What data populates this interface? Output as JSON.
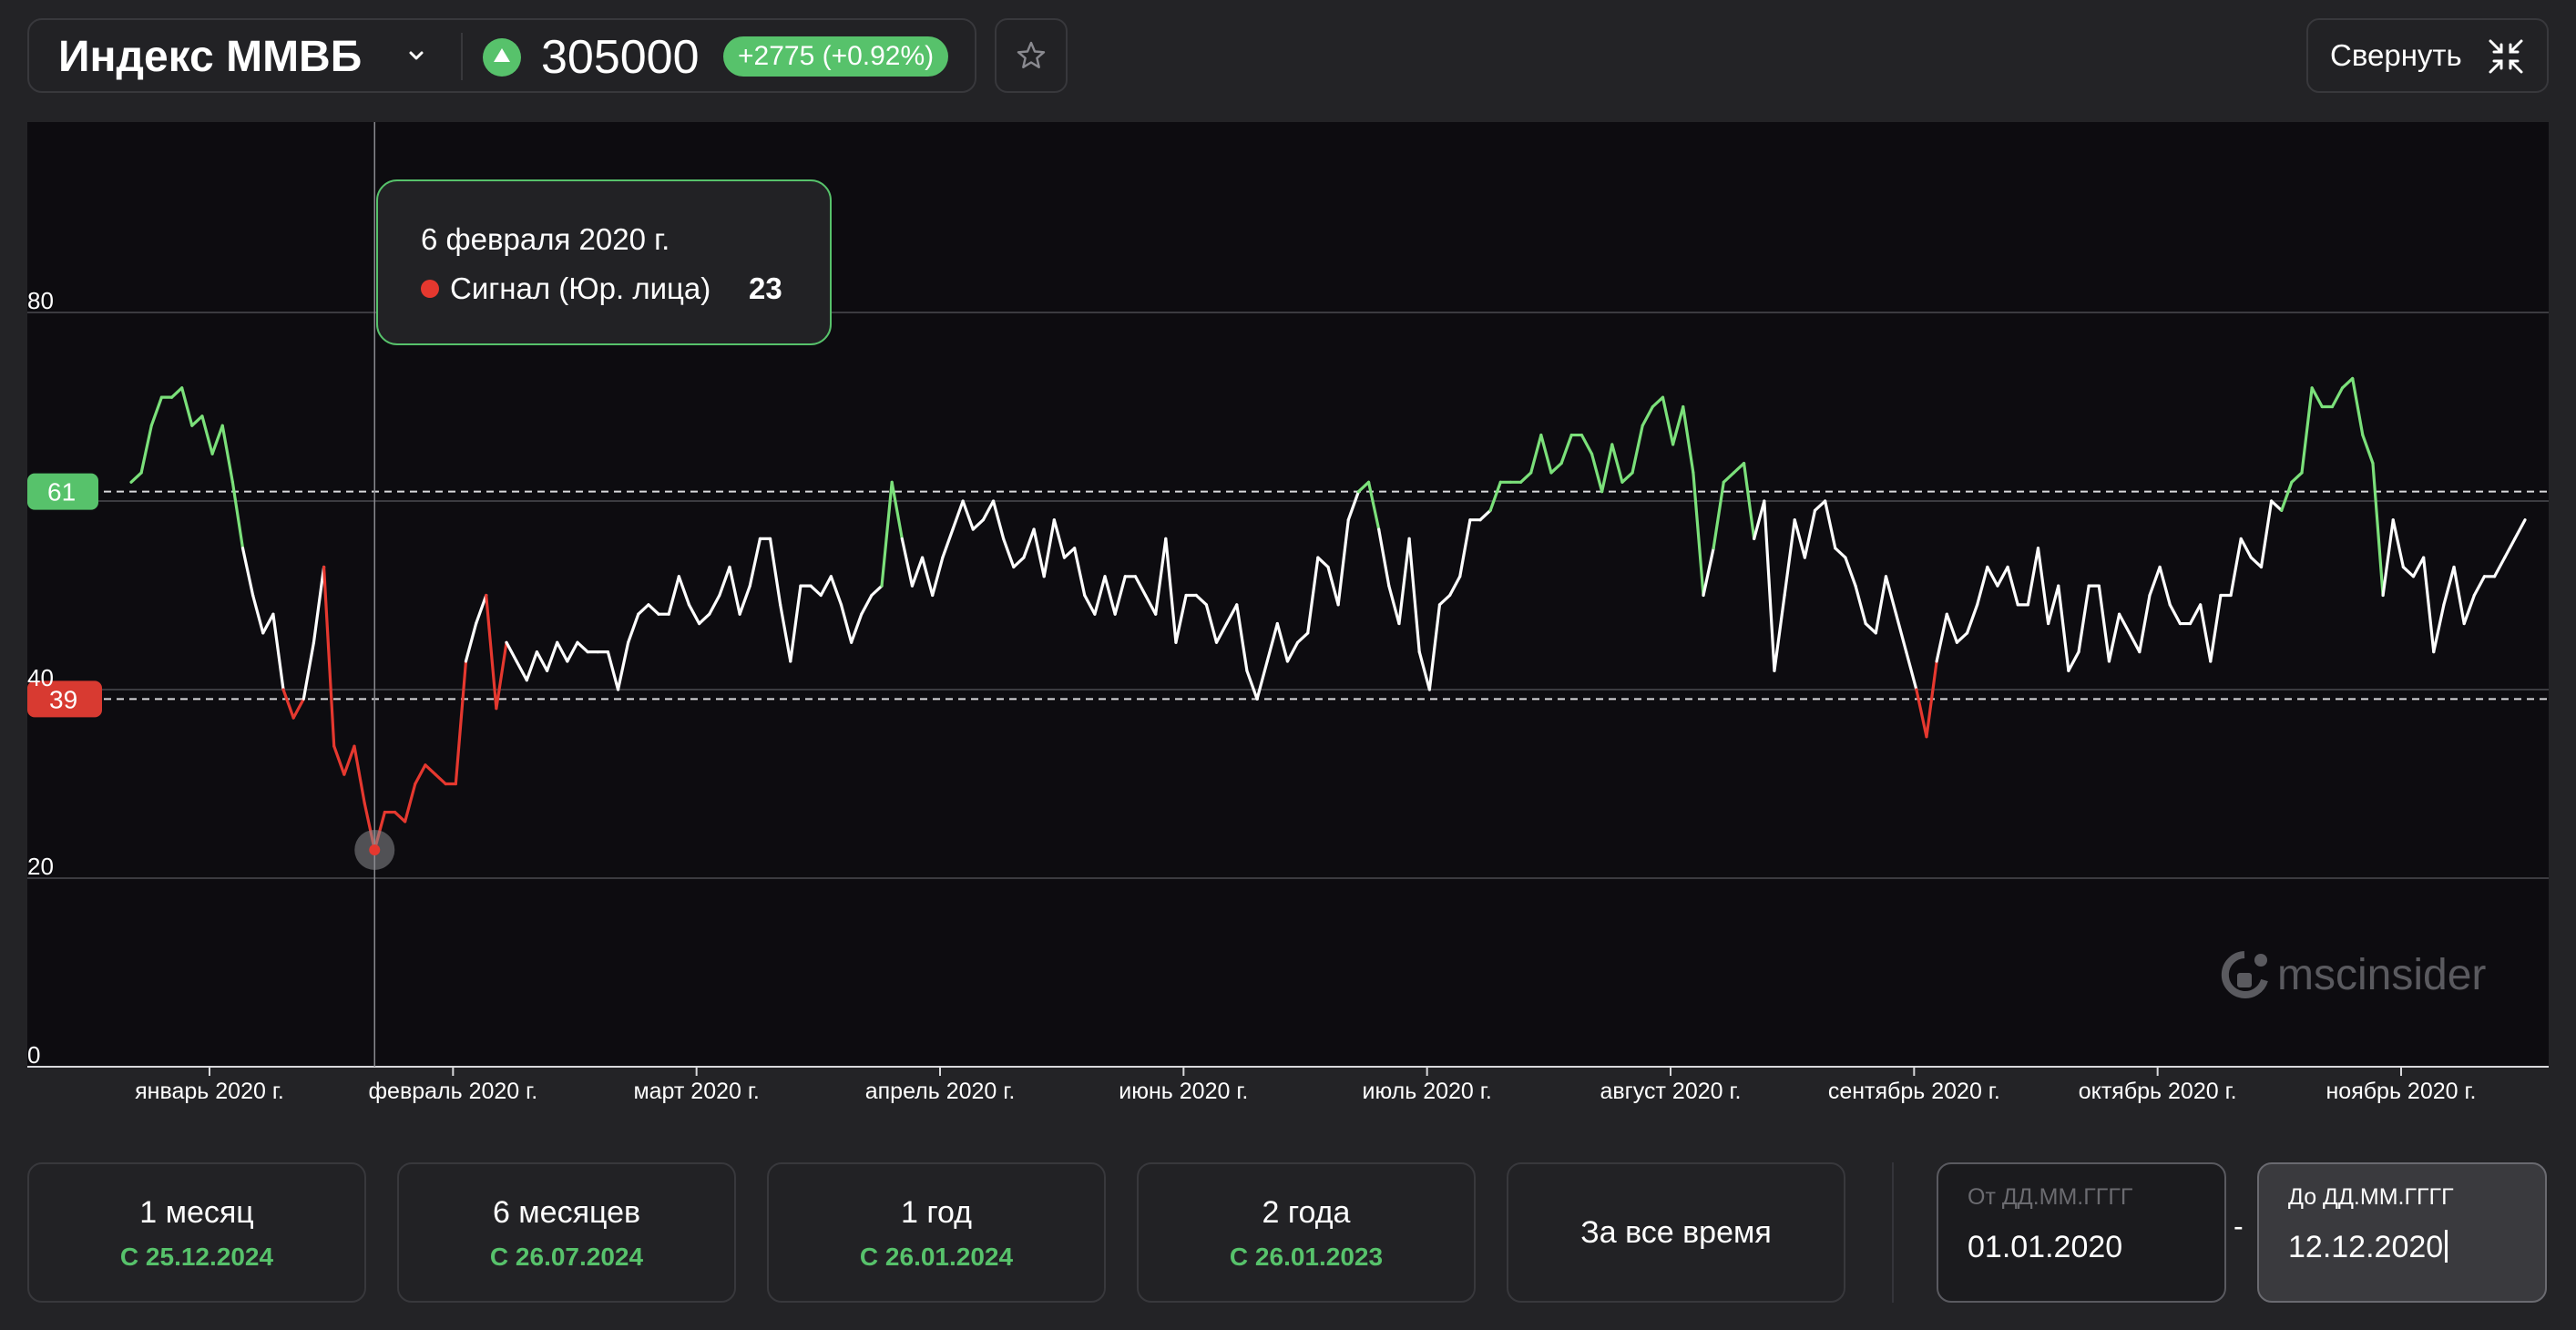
{
  "header": {
    "index_name": "Индекс ММВБ",
    "value": "305000",
    "change": "+2775 (+0.92%)",
    "collapse_label": "Свернуть",
    "up_color": "#57c26b",
    "icons": {
      "dropdown": "chevron-down-icon",
      "trend": "arrow-up-icon",
      "favorite": "star-icon",
      "collapse": "collapse-arrows-icon"
    }
  },
  "tooltip": {
    "date": "6 февраля 2020 г.",
    "series_name": "Сигнал (Юр. лица)",
    "value": "23"
  },
  "watermark": "mscinsider",
  "chart_data": {
    "type": "line",
    "ylim": [
      0,
      100
    ],
    "y_ticks": [
      0,
      20,
      40,
      80
    ],
    "grid": true,
    "legend": "none",
    "x_tick_labels": [
      "январь 2020 г.",
      "февраль 2020 г.",
      "март 2020 г.",
      "апрель 2020 г.",
      "июнь 2020 г.",
      "июль 2020 г.",
      "август 2020 г.",
      "сентябрь 2020 г.",
      "октябрь 2020 г.",
      "ноябрь 2020 г."
    ],
    "thresholds": {
      "upper": 61,
      "lower": 39
    },
    "colors": {
      "above": "#7be07a",
      "below": "#e5382f",
      "normal": "#ffffff",
      "upper_badge": "#57c26b",
      "lower_badge": "#d83a31"
    },
    "highlighted_point": {
      "date": "6 февраля 2020 г.",
      "value": 23
    },
    "series": [
      {
        "name": "Сигнал (Юр. лица)",
        "values": [
          62,
          63,
          68,
          71,
          71,
          72,
          68,
          69,
          65,
          68,
          62,
          55,
          50,
          46,
          48,
          40,
          37,
          39,
          45,
          53,
          34,
          31,
          34,
          28,
          23,
          27,
          27,
          26,
          30,
          32,
          31,
          30,
          30,
          43,
          47,
          50,
          38,
          45,
          43,
          41,
          44,
          42,
          45,
          43,
          45,
          44,
          44,
          44,
          40,
          45,
          48,
          49,
          48,
          48,
          52,
          49,
          47,
          48,
          50,
          53,
          48,
          51,
          56,
          56,
          49,
          43,
          51,
          51,
          50,
          52,
          49,
          45,
          48,
          50,
          51,
          62,
          56,
          51,
          54,
          50,
          54,
          57,
          60,
          57,
          58,
          60,
          56,
          53,
          54,
          57,
          52,
          58,
          54,
          55,
          50,
          48,
          52,
          48,
          52,
          52,
          50,
          48,
          56,
          45,
          50,
          50,
          49,
          45,
          47,
          49,
          42,
          39,
          43,
          47,
          43,
          45,
          46,
          54,
          53,
          49,
          58,
          61,
          62,
          57,
          51,
          47,
          56,
          44,
          40,
          49,
          50,
          52,
          58,
          58,
          59,
          62,
          62,
          62,
          63,
          67,
          63,
          64,
          67,
          67,
          65,
          61,
          66,
          62,
          63,
          68,
          70,
          71,
          66,
          70,
          63,
          50,
          55,
          62,
          63,
          64,
          56,
          60,
          42,
          50,
          58,
          54,
          59,
          60,
          55,
          54,
          51,
          47,
          46,
          52,
          48,
          44,
          40,
          35,
          43,
          48,
          45,
          46,
          49,
          53,
          51,
          53,
          49,
          49,
          55,
          47,
          51,
          42,
          44,
          51,
          51,
          43,
          48,
          46,
          44,
          50,
          53,
          49,
          47,
          47,
          49,
          43,
          50,
          50,
          56,
          54,
          53,
          60,
          59,
          62,
          63,
          72,
          70,
          70,
          72,
          73,
          67,
          64,
          50,
          58,
          53,
          52,
          54,
          44,
          49,
          53,
          47,
          50,
          52,
          52,
          54,
          56,
          58
        ]
      }
    ]
  },
  "periods": [
    {
      "name": "1 месяц",
      "since": "С 25.12.2024"
    },
    {
      "name": "6 месяцев",
      "since": "С 26.07.2024"
    },
    {
      "name": "1 год",
      "since": "С 26.01.2024"
    },
    {
      "name": "2 года",
      "since": "С 26.01.2023"
    }
  ],
  "period_all": "За все время",
  "date_from": {
    "label": "От ДД.ММ.ГГГГ",
    "value": "01.01.2020"
  },
  "date_to": {
    "label": "До ДД.ММ.ГГГГ",
    "value": "12.12.2020"
  },
  "date_separator": "-"
}
